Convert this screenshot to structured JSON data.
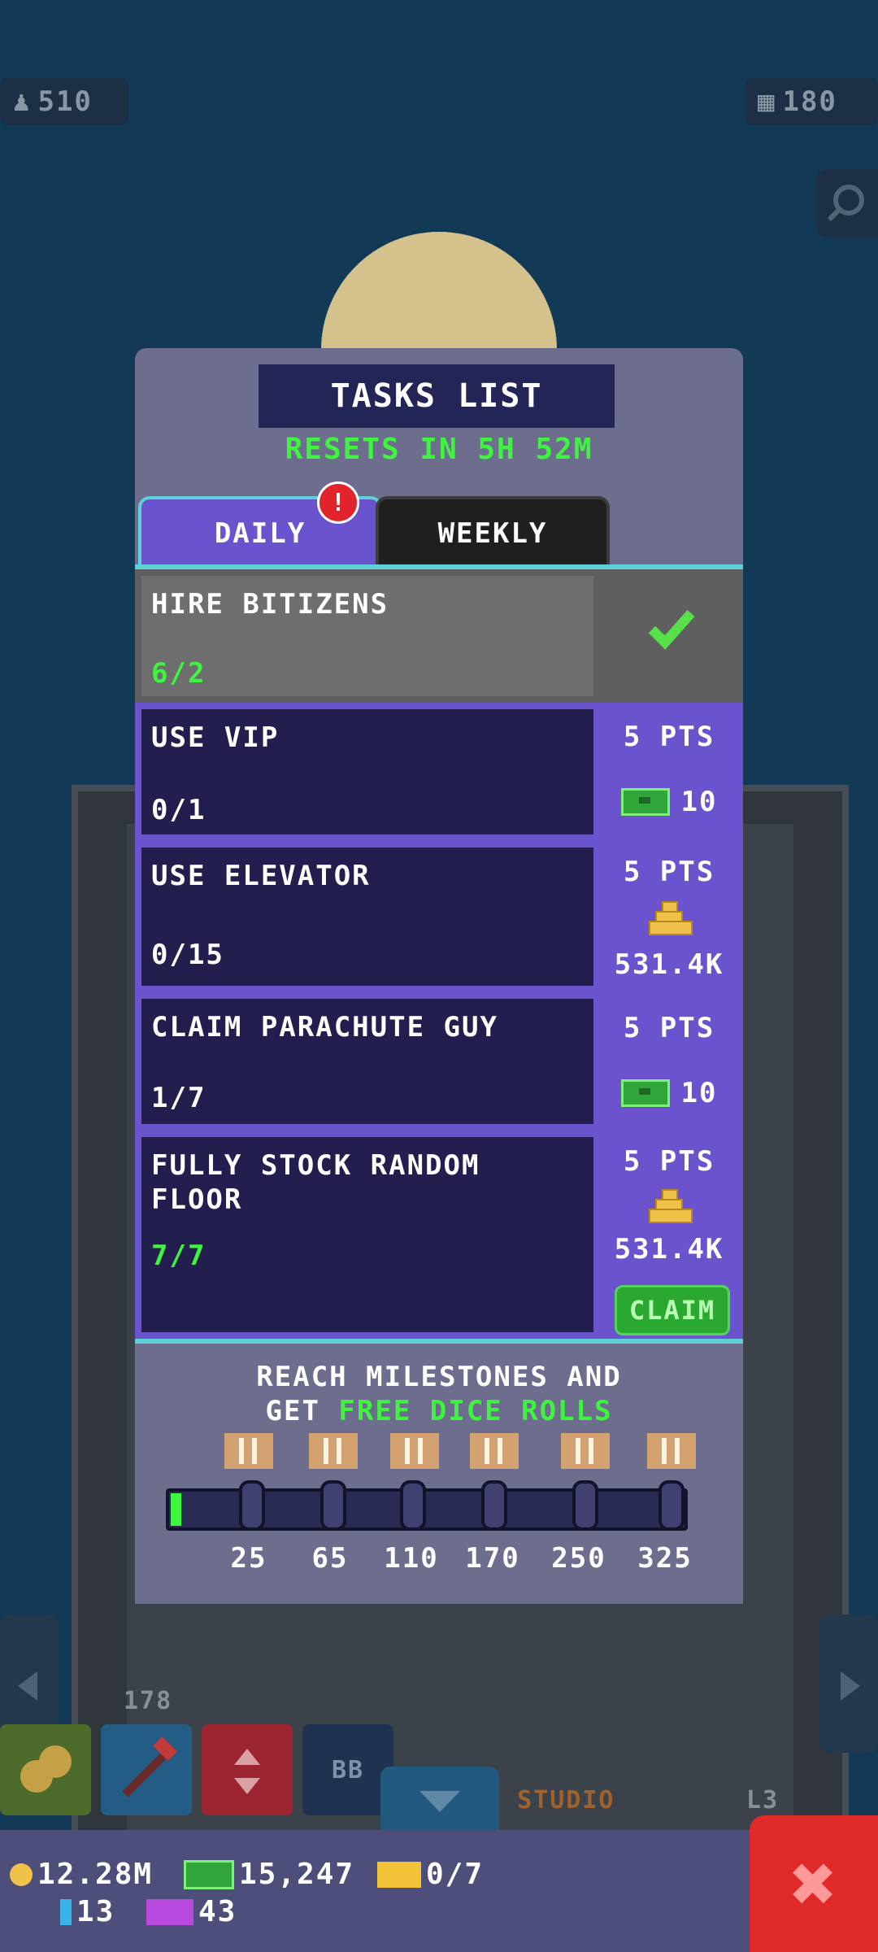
{
  "hud": {
    "population": "510",
    "floors": "180"
  },
  "scene": {
    "floor_numbers": [
      "178"
    ],
    "toolbar_label_bb": "BB",
    "studio_label": "S STUDIO",
    "floor_marker": "L3"
  },
  "modal": {
    "title": "TASKS LIST",
    "reset_text": "RESETS IN 5H 52M",
    "tabs": [
      {
        "label": "DAILY",
        "active": true
      },
      {
        "label": "WEEKLY",
        "active": false
      }
    ],
    "alert_badge": "!",
    "tasks": [
      {
        "name": "HIRE BITIZENS",
        "progress": "6/2",
        "completed": true
      },
      {
        "name": "USE VIP",
        "progress": "0/1",
        "points": "5 PTS",
        "reward": "10",
        "reward_icon": "cash-icon"
      },
      {
        "name": "USE ELEVATOR",
        "progress": "0/15",
        "points": "5 PTS",
        "reward": "531.4K",
        "reward_icon": "gold-coins-icon"
      },
      {
        "name": "CLAIM PARACHUTE GUY",
        "progress": "1/7",
        "points": "5 PTS",
        "reward": "10",
        "reward_icon": "cash-icon"
      },
      {
        "name": "FULLY STOCK RANDOM FLOOR",
        "progress": "7/7",
        "points": "5 PTS",
        "reward": "531.4K",
        "reward_icon": "gold-coins-icon"
      }
    ],
    "claim_label": "CLAIM",
    "milestones": {
      "line1": "REACH MILESTONES AND",
      "line2_prefix": "GET ",
      "line2_highlight": "FREE DICE ROLLS",
      "values": [
        "25",
        "65",
        "110",
        "170",
        "250",
        "325"
      ],
      "progress_fraction": 0.02
    }
  },
  "resources": {
    "coins": "12.28M",
    "bux": "15,247",
    "tickets": "0/7",
    "keys": "13",
    "vip": "43"
  },
  "colors": {
    "accent_green": "#3ff43f",
    "tab_active": "#6a53cc",
    "panel": "#6d6e8d",
    "close": "#e02a2a"
  }
}
